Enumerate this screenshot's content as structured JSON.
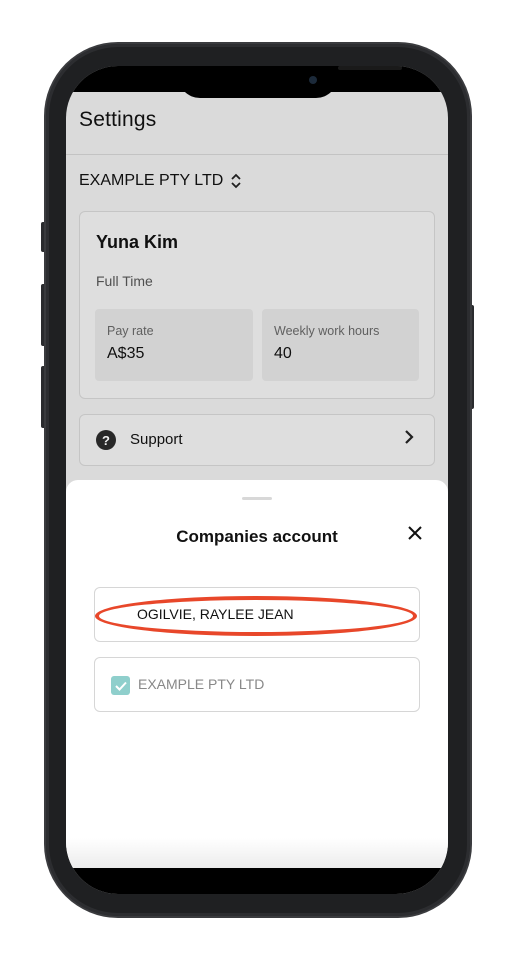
{
  "settings": {
    "title": "Settings",
    "company_selector": "EXAMPLE PTY LTD",
    "employee": {
      "name": "Yuna Kim",
      "employment_type": "Full Time",
      "pay_rate_label": "Pay rate",
      "pay_rate_value": "A$35",
      "hours_label": "Weekly work hours",
      "hours_value": "40"
    },
    "support_label": "Support"
  },
  "sheet": {
    "title": "Companies account",
    "accounts": [
      {
        "label": "OGILVIE, RAYLEE JEAN",
        "checked": false
      },
      {
        "label": "EXAMPLE PTY LTD",
        "checked": true
      }
    ]
  },
  "colors": {
    "highlight": "#e8472a",
    "checkbox": "#8fcfcc"
  }
}
